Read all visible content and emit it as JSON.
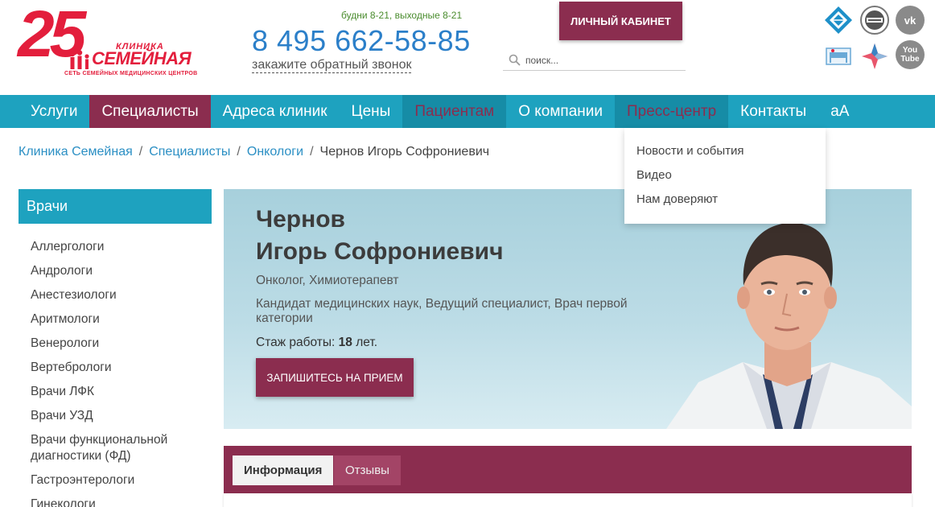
{
  "header": {
    "logo": {
      "number": "25",
      "klinika": "КЛИНИКА",
      "name": "СЕМЕЙНАЯ",
      "subtitle": "СЕТЬ СЕМЕЙНЫХ МЕДИЦИНСКИХ ЦЕНТРОВ"
    },
    "hours": "будни 8-21, выходные 8-21",
    "phone": "8 495 662-58-85",
    "callback": "закажите обратный звонок",
    "cabinet_label": "ЛИЧНЫЙ КАБИНЕТ",
    "search_placeholder": "поиск...",
    "social": {
      "vk": "vk",
      "youtube_top": "You",
      "youtube_bottom": "Tube"
    }
  },
  "nav": {
    "items": [
      {
        "label": "Услуги"
      },
      {
        "label": "Специалисты"
      },
      {
        "label": "Адреса клиник"
      },
      {
        "label": "Цены"
      },
      {
        "label": "Пациентам"
      },
      {
        "label": "О компании"
      },
      {
        "label": "Пресс-центр"
      },
      {
        "label": "Контакты"
      },
      {
        "label": "aA"
      }
    ],
    "dropdown": [
      "Новости и события",
      "Видео",
      "Нам доверяют"
    ]
  },
  "breadcrumb": {
    "items": [
      "Клиника Семейная",
      "Специалисты",
      "Онкологи"
    ],
    "current": "Чернов Игорь Софрониевич",
    "separator": "/"
  },
  "sidebar": {
    "title": "Врачи",
    "items": [
      "Аллергологи",
      "Андрологи",
      "Анестезиологи",
      "Аритмологи",
      "Венерологи",
      "Вертебрологи",
      "Врачи ЛФК",
      "Врачи УЗД",
      "Врачи функциональной диагностики (ФД)",
      "Гастроэнтерологи",
      "Гинекологи"
    ]
  },
  "doctor": {
    "surname": "Чернов",
    "given_names": "Игорь Софрониевич",
    "specialty": "Онколог, Химиотерапевт",
    "degree": "Кандидат медицинских наук, Ведущий специалист, Врач первой категории",
    "experience_label": "Стаж работы:",
    "experience_value": "18",
    "experience_unit": "лет.",
    "appointment_label": "ЗАПИШИТЕСЬ НА ПРИЕМ"
  },
  "tabs": [
    {
      "label": "Информация"
    },
    {
      "label": "Отзывы"
    }
  ],
  "colors": {
    "brand_red": "#e31e3c",
    "accent_maroon": "#8b2d4f",
    "nav_teal": "#1ea2bf",
    "phone_blue": "#2b7fc9"
  }
}
